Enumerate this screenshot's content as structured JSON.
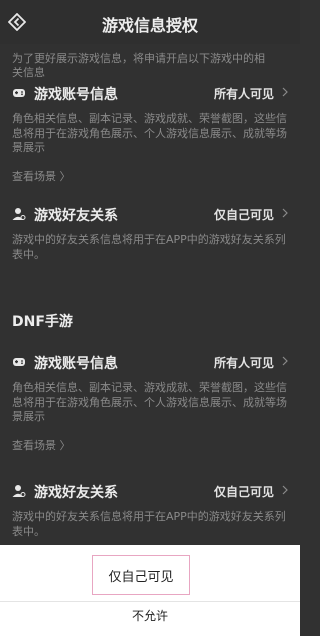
{
  "header": {
    "title": "游戏信息授权"
  },
  "intro": {
    "line1": "为了更好展示游戏信息，将申请开启以下游戏中的相",
    "line2": "关信息"
  },
  "section1": {
    "label": "游戏账号信息",
    "value": "所有人可见",
    "desc": "角色相关信息、副本记录、游戏成就、荣誉截图，这些信息将用于在游戏角色展示、个人游戏信息展示、成就等场景展示",
    "link": "查看场景 〉"
  },
  "section2": {
    "label": "游戏好友关系",
    "value": "仅自己可见",
    "desc": "游戏中的好友关系信息将用于在APP中的游戏好友关系列表中。"
  },
  "game2": {
    "name": "DNF手游"
  },
  "section3": {
    "label": "游戏账号信息",
    "value": "所有人可见",
    "desc": "角色相关信息、副本记录、游戏成就、荣誉截图，这些信息将用于在游戏角色展示、个人游戏信息展示、成就等场景展示",
    "link": "查看场景 〉"
  },
  "section4": {
    "label": "游戏好友关系",
    "value": "仅自己可见",
    "desc": "游戏中的好友关系信息将用于在APP中的游戏好友关系列表中。"
  },
  "sheet": {
    "option_self": "仅自己可见",
    "option_deny": "不允许"
  }
}
